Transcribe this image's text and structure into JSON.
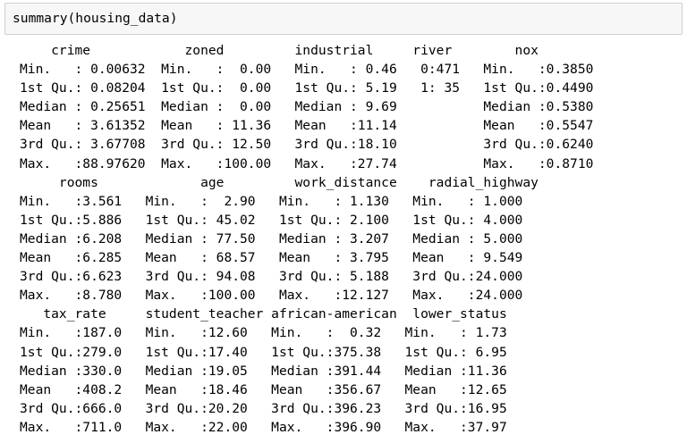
{
  "input": {
    "code": "summary(housing_data)"
  },
  "output": {
    "lines": [
      "    crime            zoned         industrial     river        nox        ",
      "Min.   : 0.00632  Min.   :  0.00   Min.   : 0.46   0:471   Min.   :0.3850  ",
      "1st Qu.: 0.08204  1st Qu.:  0.00   1st Qu.: 5.19   1: 35   1st Qu.:0.4490  ",
      "Median : 0.25651  Median :  0.00   Median : 9.69           Median :0.5380  ",
      "Mean   : 3.61352  Mean   : 11.36   Mean   :11.14           Mean   :0.5547  ",
      "3rd Qu.: 3.67708  3rd Qu.: 12.50   3rd Qu.:18.10           3rd Qu.:0.6240  ",
      "Max.   :88.97620  Max.   :100.00   Max.   :27.74           Max.   :0.8710  ",
      "     rooms             age         work_distance    radial_highway  ",
      "Min.   :3.561   Min.   :  2.90   Min.   : 1.130   Min.   : 1.000  ",
      "1st Qu.:5.886   1st Qu.: 45.02   1st Qu.: 2.100   1st Qu.: 4.000  ",
      "Median :6.208   Median : 77.50   Median : 3.207   Median : 5.000  ",
      "Mean   :6.285   Mean   : 68.57   Mean   : 3.795   Mean   : 9.549  ",
      "3rd Qu.:6.623   3rd Qu.: 94.08   3rd Qu.: 5.188   3rd Qu.:24.000  ",
      "Max.   :8.780   Max.   :100.00   Max.   :12.127   Max.   :24.000  ",
      "   tax_rate     student_teacher african-american  lower_status  ",
      "Min.   :187.0   Min.   :12.60   Min.   :  0.32   Min.   : 1.73  ",
      "1st Qu.:279.0   1st Qu.:17.40   1st Qu.:375.38   1st Qu.: 6.95  ",
      "Median :330.0   Median :19.05   Median :391.44   Median :11.36  ",
      "Mean   :408.2   Mean   :18.46   Mean   :356.67   Mean   :12.65  ",
      "3rd Qu.:666.0   3rd Qu.:20.20   3rd Qu.:396.23   3rd Qu.:16.95  ",
      "Max.   :711.0   Max.   :22.00   Max.   :396.90   Max.   :37.97  "
    ]
  }
}
